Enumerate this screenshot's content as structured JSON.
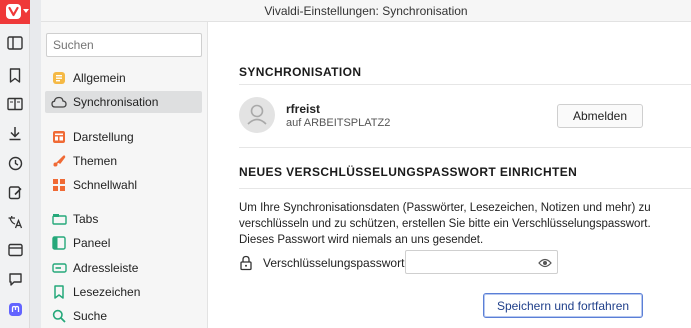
{
  "window": {
    "title": "Vivaldi-Einstellungen: Synchronisation"
  },
  "panelbar": {
    "icons": [
      "vivaldi-logo-icon",
      "panel-toggle-icon",
      "bookmark-icon",
      "reading-list-icon",
      "download-icon",
      "history-icon",
      "notes-icon",
      "translate-icon",
      "window-icon",
      "chat-icon",
      "mastodon-icon"
    ]
  },
  "nav": {
    "search_placeholder": "Suchen",
    "items": [
      {
        "label": "Allgemein",
        "icon": "general-icon"
      },
      {
        "label": "Synchronisation",
        "icon": "cloud-icon",
        "active": true
      },
      {
        "label": "Darstellung",
        "icon": "appearance-icon"
      },
      {
        "label": "Themen",
        "icon": "themes-icon"
      },
      {
        "label": "Schnellwahl",
        "icon": "speed-dial-icon"
      },
      {
        "label": "Tabs",
        "icon": "tabs-icon"
      },
      {
        "label": "Paneel",
        "icon": "panel-icon"
      },
      {
        "label": "Adressleiste",
        "icon": "address-bar-icon"
      },
      {
        "label": "Lesezeichen",
        "icon": "bookmark-icon"
      },
      {
        "label": "Suche",
        "icon": "search-icon"
      }
    ]
  },
  "sync": {
    "heading": "SYNCHRONISATION",
    "user_name": "rfreist",
    "device": "auf ARBEITSPLATZ2",
    "logout_label": "Abmelden"
  },
  "encryption": {
    "heading": "NEUES VERSCHLÜSSELUNGSPASSWORT EINRICHTEN",
    "line1": "Um Ihre Synchronisationsdaten (Passwörter, Lesezeichen, Notizen und mehr) zu",
    "line2": "verschlüsseln und zu schützen, erstellen Sie bitte ein Verschlüsselungspasswort.",
    "line3": "Dieses Passwort wird niemals an uns gesendet.",
    "password_label": "Verschlüsselungspasswort",
    "password_value": "",
    "save_label": "Speichern und fortfahren"
  },
  "colors": {
    "vivaldi_red": "#ef3939",
    "primary_button_border": "#5b7fd6",
    "active_nav_bg": "#dedfe0"
  }
}
